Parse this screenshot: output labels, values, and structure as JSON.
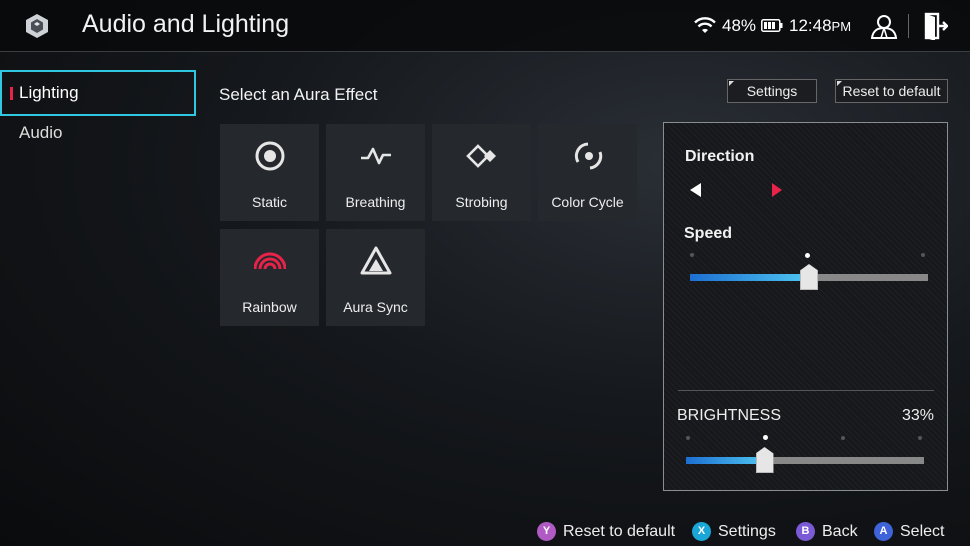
{
  "header": {
    "title": "Audio and Lighting",
    "battery_percent": "48%",
    "time": "12:48",
    "ampm": "PM"
  },
  "sidebar": {
    "items": [
      {
        "label": "Lighting",
        "active": true
      },
      {
        "label": "Audio",
        "active": false
      }
    ]
  },
  "main": {
    "section_title": "Select an Aura Effect",
    "effects": [
      {
        "label": "Static",
        "icon": "static-icon"
      },
      {
        "label": "Breathing",
        "icon": "breathing-icon"
      },
      {
        "label": "Strobing",
        "icon": "strobing-icon"
      },
      {
        "label": "Color Cycle",
        "icon": "color-cycle-icon"
      },
      {
        "label": "Rainbow",
        "icon": "rainbow-icon"
      },
      {
        "label": "Aura Sync",
        "icon": "aura-sync-icon"
      }
    ],
    "settings_button": "Settings",
    "reset_button": "Reset to default"
  },
  "panel": {
    "direction_label": "Direction",
    "speed_label": "Speed",
    "speed_level": 0.5,
    "brightness_label": "BRIGHTNESS",
    "brightness_value": "33%",
    "brightness_level": 0.33
  },
  "footer": {
    "hints": [
      {
        "button": "Y",
        "label": "Reset to default",
        "color": "#b05bc4"
      },
      {
        "button": "X",
        "label": "Settings",
        "color": "#1aa6d6"
      },
      {
        "button": "B",
        "label": "Back",
        "color": "#7b5ad6"
      },
      {
        "button": "A",
        "label": "Select",
        "color": "#3f63d8"
      }
    ]
  },
  "colors": {
    "accent_cyan": "#2fc8e0",
    "accent_red": "#e8234a",
    "slider_fill": "#4ec5f0"
  }
}
